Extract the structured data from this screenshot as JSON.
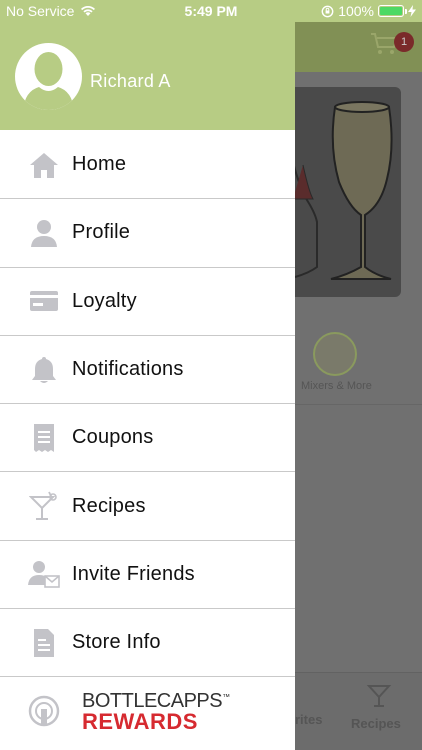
{
  "status": {
    "carrier": "No Service",
    "time": "5:49 PM",
    "battery": "100%",
    "battery_level": 1.0
  },
  "user": {
    "name": "Richard A"
  },
  "menu": {
    "items": [
      {
        "label": "Home",
        "icon": "home-icon"
      },
      {
        "label": "Profile",
        "icon": "profile-icon"
      },
      {
        "label": "Loyalty",
        "icon": "loyalty-card-icon"
      },
      {
        "label": "Notifications",
        "icon": "bell-icon"
      },
      {
        "label": "Coupons",
        "icon": "coupon-icon"
      },
      {
        "label": "Recipes",
        "icon": "cocktail-icon"
      },
      {
        "label": "Invite Friends",
        "icon": "invite-friends-icon"
      },
      {
        "label": "Store Info",
        "icon": "store-info-icon"
      }
    ]
  },
  "brand": {
    "line1": "BOTTLECAPPS",
    "tm": "™",
    "line2": "REWARDS"
  },
  "background": {
    "cart_count": "1",
    "category_label": "Mixers & More",
    "tab_favorites": "rites",
    "tab_recipes": "Recipes"
  },
  "colors": {
    "accent": "#b7cc84",
    "brand_red": "#d62a30",
    "icon_gray": "#c3c3c8"
  }
}
